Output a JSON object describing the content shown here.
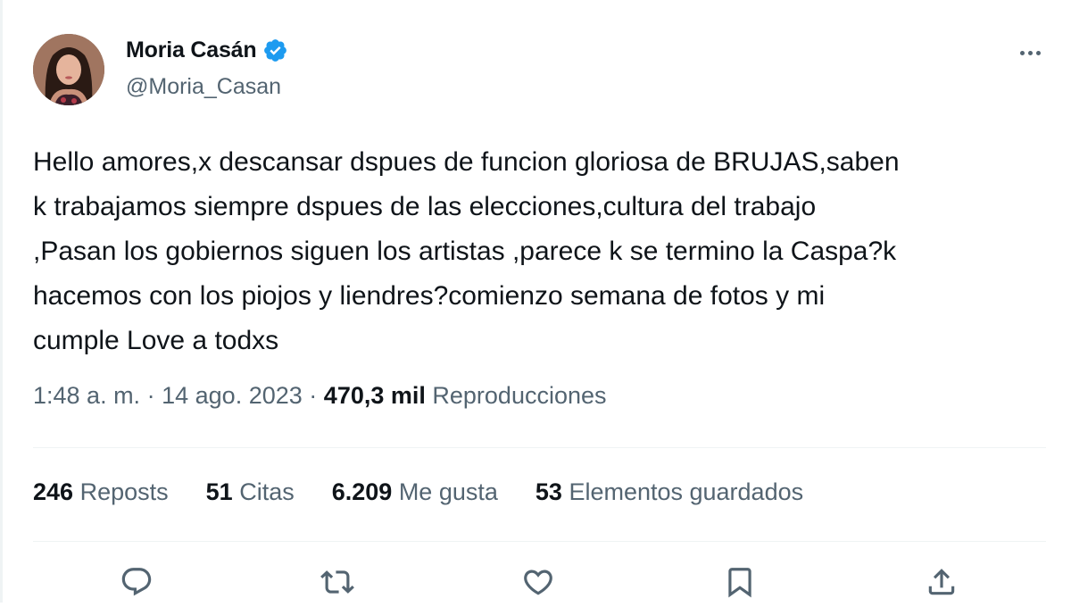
{
  "author": {
    "display_name": "Moria Casán",
    "handle": "@Moria_Casan",
    "verified": true
  },
  "tweet": {
    "text_lines": [
      "Hello amores,x descansar dspues de funcion gloriosa de BRUJAS,saben",
      "k trabajamos siempre dspues de las elecciones,cultura del trabajo",
      ",Pasan los gobiernos siguen los artistas ,parece k se termino la Caspa?k",
      "hacemos con los piojos y liendres?comienzo semana de fotos y mi",
      "cumple Love a todxs"
    ]
  },
  "meta": {
    "time": "1:48 a. m.",
    "separator": "·",
    "date": "14 ago. 2023",
    "views_count": "470,3 mil",
    "views_label": "Reproducciones"
  },
  "stats": [
    {
      "count": "246",
      "label": "Reposts"
    },
    {
      "count": "51",
      "label": "Citas"
    },
    {
      "count": "6.209",
      "label": "Me gusta"
    },
    {
      "count": "53",
      "label": "Elementos guardados"
    }
  ],
  "actions": [
    "reply-icon",
    "repost-icon",
    "like-icon",
    "bookmark-icon",
    "share-icon"
  ],
  "colors": {
    "text_primary": "#0f1419",
    "text_secondary": "#536471",
    "divider": "#eff3f4",
    "verified_badge": "#1d9bf0"
  }
}
